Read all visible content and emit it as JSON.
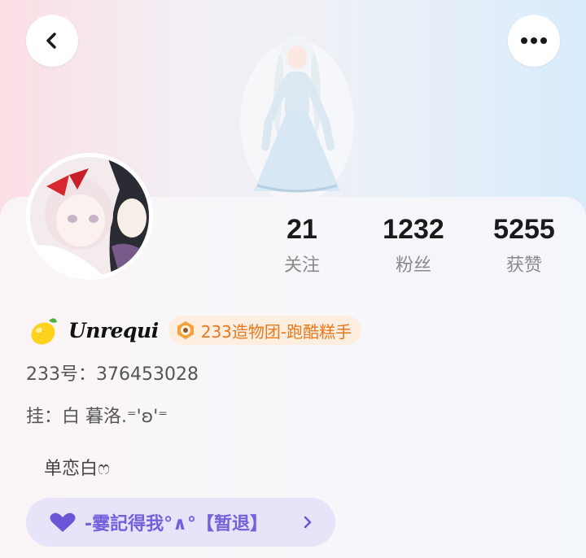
{
  "header": {
    "back_icon": "chevron-left-icon",
    "more_icon": "more-dots-icon"
  },
  "stats": [
    {
      "value": "21",
      "label": "关注"
    },
    {
      "value": "1232",
      "label": "粉丝"
    },
    {
      "value": "5255",
      "label": "获赞"
    }
  ],
  "profile": {
    "name_icon": "lemon-icon",
    "display_name": "Unrequi",
    "tag": {
      "icon": "team-badge-icon",
      "label": "233造物团-跑酷糕手"
    },
    "account_line": "233号：376453028",
    "hang_line": "挂：白  暮洛.⁼'ʚ'⁼",
    "bio": "单恋白ෆ"
  },
  "group": {
    "icon": "heart-icon",
    "label": "-霎記得我°∧°【暂退】",
    "chevron_icon": "chevron-right-icon"
  },
  "colors": {
    "tag_text": "#e8781e",
    "tag_bg": "#fdeee0",
    "group_text": "#7460dc",
    "group_bg": "#e7e3f8"
  }
}
